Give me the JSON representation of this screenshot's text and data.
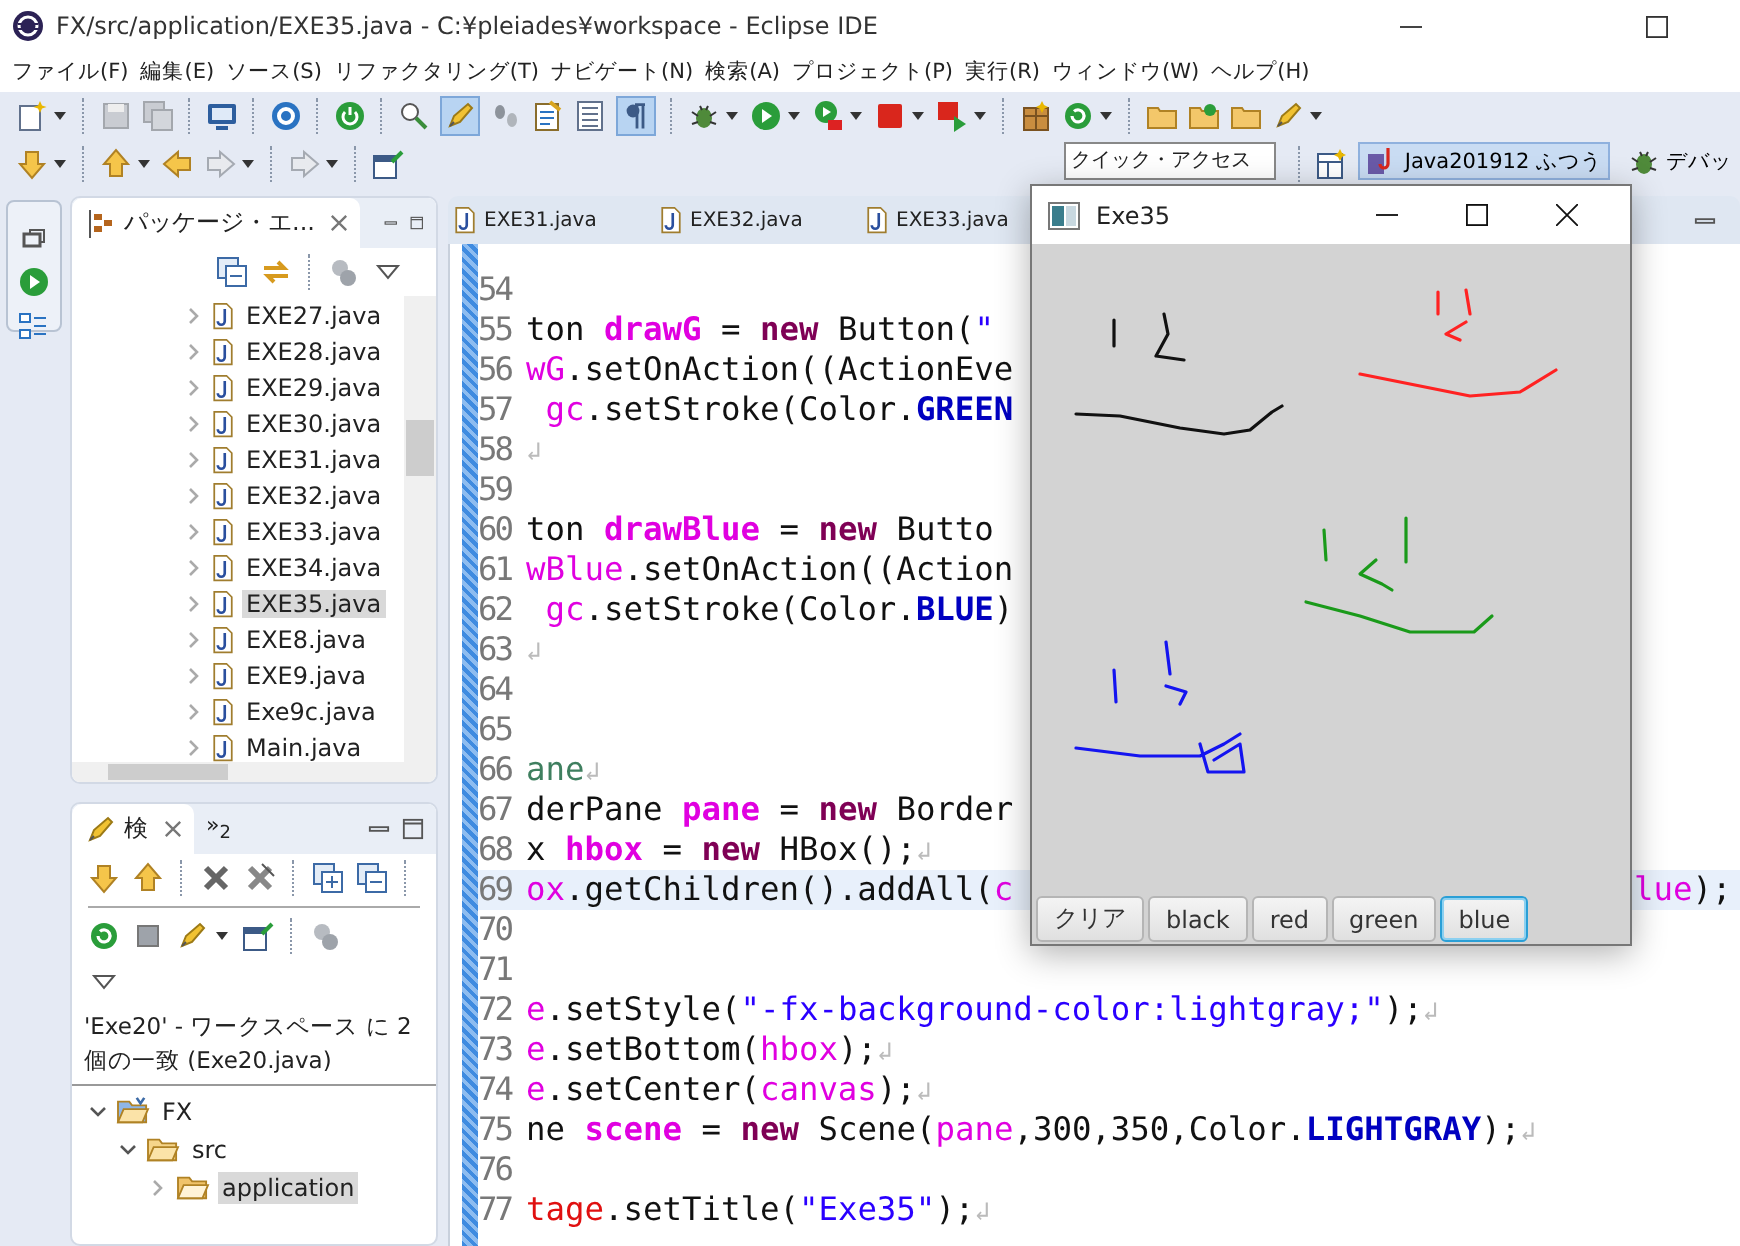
{
  "window": {
    "title": "FX/src/application/EXE35.java - C:¥pleiades¥workspace - Eclipse IDE"
  },
  "menu": [
    "ファイル(F)",
    "編集(E)",
    "ソース(S)",
    "リファクタリング(T)",
    "ナビゲート(N)",
    "検索(A)",
    "プロジェクト(P)",
    "実行(R)",
    "ウィンドウ(W)",
    "ヘルプ(H)"
  ],
  "toolbar": {
    "toggles": [
      {
        "on": true
      },
      {
        "on": true
      }
    ]
  },
  "quick_access": {
    "placeholder": "クイック・アクセス"
  },
  "perspectives": [
    {
      "label": "Java201912 ふつう",
      "selected": true
    },
    {
      "label": "デバッ",
      "selected": false
    }
  ],
  "package_explorer": {
    "tab": "パッケージ・エ...",
    "items": [
      {
        "label": "EXE27.java",
        "selected": false
      },
      {
        "label": "EXE28.java",
        "selected": false
      },
      {
        "label": "EXE29.java",
        "selected": false
      },
      {
        "label": "EXE30.java",
        "selected": false
      },
      {
        "label": "EXE31.java",
        "selected": false
      },
      {
        "label": "EXE32.java",
        "selected": false
      },
      {
        "label": "EXE33.java",
        "selected": false
      },
      {
        "label": "EXE34.java",
        "selected": false
      },
      {
        "label": "EXE35.java",
        "selected": true
      },
      {
        "label": "EXE8.java",
        "selected": false
      },
      {
        "label": "EXE9.java",
        "selected": false
      },
      {
        "label": "Exe9c.java",
        "selected": false
      },
      {
        "label": "Main.java",
        "selected": false
      }
    ]
  },
  "search_view": {
    "tab": "検",
    "overflow": {
      "label": "»",
      "count": "2"
    },
    "summary": "'Exe20' - ワークスペース に 2 個の一致 (Exe20.java)",
    "tree": [
      {
        "label": "FX",
        "kind": "project",
        "expanded": true,
        "selected": false,
        "children": [
          {
            "label": "src",
            "kind": "folder",
            "expanded": true,
            "selected": false,
            "children": [
              {
                "label": "application",
                "kind": "package",
                "expanded": false,
                "selected": true
              }
            ]
          }
        ]
      }
    ]
  },
  "editor": {
    "tabs": [
      {
        "label": "EXE31.java",
        "selected": false
      },
      {
        "label": "EXE32.java",
        "selected": false
      },
      {
        "label": "EXE33.java",
        "selected": false
      }
    ],
    "lines": [
      {
        "number": "54",
        "current": false
      },
      {
        "number": "55",
        "current": false,
        "segments": [
          {
            "text": "ton ",
            "kind": "plain"
          },
          {
            "text": "drawG",
            "kind": "field"
          },
          {
            "text": " = ",
            "kind": "plain"
          },
          {
            "text": "new",
            "kind": "keyword"
          },
          {
            "text": " Button(",
            "kind": "plain"
          },
          {
            "text": "\"",
            "kind": "string"
          }
        ]
      },
      {
        "number": "56",
        "current": false,
        "segments": [
          {
            "text": "wG",
            "kind": "local"
          },
          {
            "text": ".setOnAction((ActionEve",
            "kind": "plain"
          }
        ]
      },
      {
        "number": "57",
        "current": false,
        "segments": [
          {
            "text": " gc",
            "kind": "local"
          },
          {
            "text": ".setStroke(Color.",
            "kind": "plain"
          },
          {
            "text": "GREEN",
            "kind": "constant"
          }
        ]
      },
      {
        "number": "58",
        "current": false,
        "segments": [
          {
            "text": "↲",
            "kind": "eol"
          }
        ]
      },
      {
        "number": "59",
        "current": false
      },
      {
        "number": "60",
        "current": false,
        "segments": [
          {
            "text": "ton ",
            "kind": "plain"
          },
          {
            "text": "drawBlue",
            "kind": "field"
          },
          {
            "text": " = ",
            "kind": "plain"
          },
          {
            "text": "new",
            "kind": "keyword"
          },
          {
            "text": " Butto",
            "kind": "plain"
          }
        ]
      },
      {
        "number": "61",
        "current": false,
        "segments": [
          {
            "text": "wBlue",
            "kind": "local"
          },
          {
            "text": ".setOnAction((Action",
            "kind": "plain"
          }
        ]
      },
      {
        "number": "62",
        "current": false,
        "segments": [
          {
            "text": " gc",
            "kind": "local"
          },
          {
            "text": ".setStroke(Color.",
            "kind": "plain"
          },
          {
            "text": "BLUE",
            "kind": "constant"
          },
          {
            "text": ")",
            "kind": "plain"
          }
        ]
      },
      {
        "number": "63",
        "current": false,
        "segments": [
          {
            "text": "↲",
            "kind": "eol"
          }
        ]
      },
      {
        "number": "64",
        "current": false
      },
      {
        "number": "65",
        "current": false
      },
      {
        "number": "66",
        "current": false,
        "segments": [
          {
            "text": "ane",
            "kind": "comment"
          },
          {
            "text": "↲",
            "kind": "eol"
          }
        ]
      },
      {
        "number": "67",
        "current": false,
        "segments": [
          {
            "text": "derPane ",
            "kind": "plain"
          },
          {
            "text": "pane",
            "kind": "field"
          },
          {
            "text": " = ",
            "kind": "plain"
          },
          {
            "text": "new",
            "kind": "keyword"
          },
          {
            "text": " Border",
            "kind": "plain"
          }
        ]
      },
      {
        "number": "68",
        "current": false,
        "segments": [
          {
            "text": "x ",
            "kind": "plain"
          },
          {
            "text": "hbox",
            "kind": "field"
          },
          {
            "text": " = ",
            "kind": "plain"
          },
          {
            "text": "new",
            "kind": "keyword"
          },
          {
            "text": " HBox();",
            "kind": "plain"
          },
          {
            "text": "↲",
            "kind": "eol"
          }
        ]
      },
      {
        "number": "69",
        "current": true,
        "segments": [
          {
            "text": "ox",
            "kind": "local"
          },
          {
            "text": ".getChildren().addAll(",
            "kind": "plain"
          },
          {
            "text": "c",
            "kind": "local"
          }
        ],
        "tail": [
          {
            "text": "lue",
            "kind": "local"
          },
          {
            "text": ");",
            "kind": "plain"
          }
        ]
      },
      {
        "number": "70",
        "current": false
      },
      {
        "number": "71",
        "current": false
      },
      {
        "number": "72",
        "current": false,
        "segments": [
          {
            "text": "e",
            "kind": "local"
          },
          {
            "text": ".setStyle(",
            "kind": "plain"
          },
          {
            "text": "\"-fx-background-color:lightgray;\"",
            "kind": "string"
          },
          {
            "text": ");",
            "kind": "plain"
          },
          {
            "text": "↲",
            "kind": "eol"
          }
        ]
      },
      {
        "number": "73",
        "current": false,
        "segments": [
          {
            "text": "e",
            "kind": "local"
          },
          {
            "text": ".setBottom(",
            "kind": "plain"
          },
          {
            "text": "hbox",
            "kind": "local"
          },
          {
            "text": ");",
            "kind": "plain"
          },
          {
            "text": "↲",
            "kind": "eol"
          }
        ]
      },
      {
        "number": "74",
        "current": false,
        "segments": [
          {
            "text": "e",
            "kind": "local"
          },
          {
            "text": ".setCenter(",
            "kind": "plain"
          },
          {
            "text": "canvas",
            "kind": "local"
          },
          {
            "text": ");",
            "kind": "plain"
          },
          {
            "text": "↲",
            "kind": "eol"
          }
        ]
      },
      {
        "number": "75",
        "current": false,
        "segments": [
          {
            "text": "ne ",
            "kind": "plain"
          },
          {
            "text": "scene",
            "kind": "field"
          },
          {
            "text": " = ",
            "kind": "plain"
          },
          {
            "text": "new",
            "kind": "keyword"
          },
          {
            "text": " Scene(",
            "kind": "plain"
          },
          {
            "text": "pane",
            "kind": "local"
          },
          {
            "text": ",300,350,Color.",
            "kind": "plain"
          },
          {
            "text": "LIGHTGRAY",
            "kind": "constant"
          },
          {
            "text": ");",
            "kind": "plain"
          },
          {
            "text": "↲",
            "kind": "eol"
          }
        ]
      },
      {
        "number": "76",
        "current": false
      },
      {
        "number": "77",
        "current": false,
        "segments": [
          {
            "text": "tage",
            "kind": "param"
          },
          {
            "text": ".setTitle(",
            "kind": "plain"
          },
          {
            "text": "\"Exe35\"",
            "kind": "string"
          },
          {
            "text": ");",
            "kind": "plain"
          },
          {
            "text": "↲",
            "kind": "eol"
          }
        ]
      }
    ]
  },
  "app_window": {
    "title": "Exe35",
    "buttons": [
      {
        "label": "クリア",
        "focused": false
      },
      {
        "label": "black",
        "focused": false
      },
      {
        "label": "red",
        "focused": false
      },
      {
        "label": "green",
        "focused": false
      },
      {
        "label": "blue",
        "focused": true
      }
    ]
  }
}
